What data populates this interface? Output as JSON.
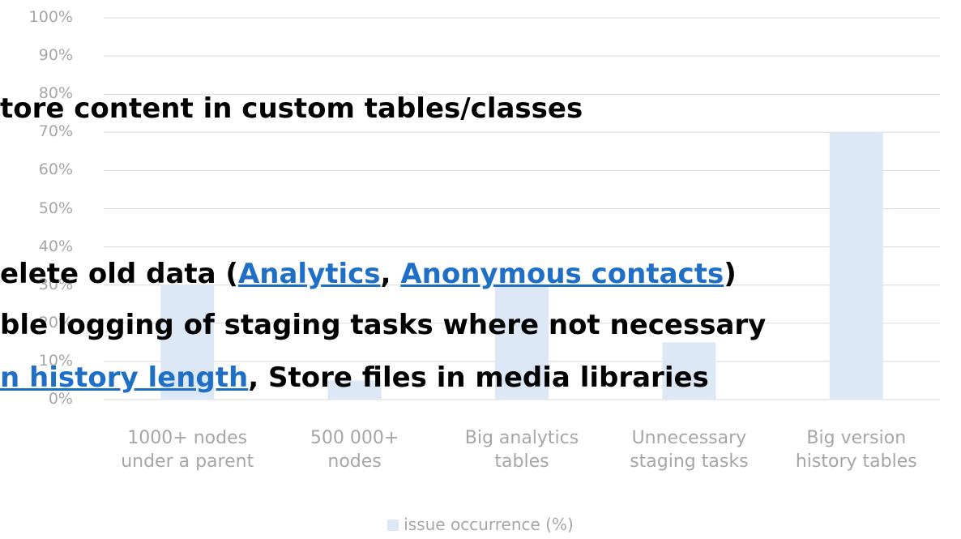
{
  "chart_data": {
    "type": "bar",
    "categories": [
      "1000+ nodes\nunder a parent",
      "500 000+\nnodes",
      "Big analytics\ntables",
      "Unnecessary\nstaging tasks",
      "Big version\nhistory tables"
    ],
    "series": [
      {
        "name": "issue occurrence (%)",
        "values": [
          30,
          5,
          30,
          15,
          70
        ]
      }
    ],
    "y_ticks": [
      "0%",
      "10%",
      "20%",
      "30%",
      "40%",
      "50%",
      "60%",
      "70%",
      "80%",
      "90%",
      "100%"
    ],
    "ylim": [
      0,
      100
    ],
    "grid": true,
    "legend_placement": "bottom",
    "bar_color": "#dce8f5",
    "grid_color": "#d9d9d9"
  },
  "overlay": {
    "line1": {
      "text": "tore content in custom tables/classes"
    },
    "line2": {
      "pre": "elete old data (",
      "link1": "Analytics",
      "mid": ", ",
      "link2": "Anonymous contacts",
      "post": ")"
    },
    "line3": {
      "text": "ble logging of staging tasks where not necessary"
    },
    "line4": {
      "link": "n history length",
      "post": ", Store files in media libraries"
    },
    "link_color": "#1f6fc6"
  }
}
